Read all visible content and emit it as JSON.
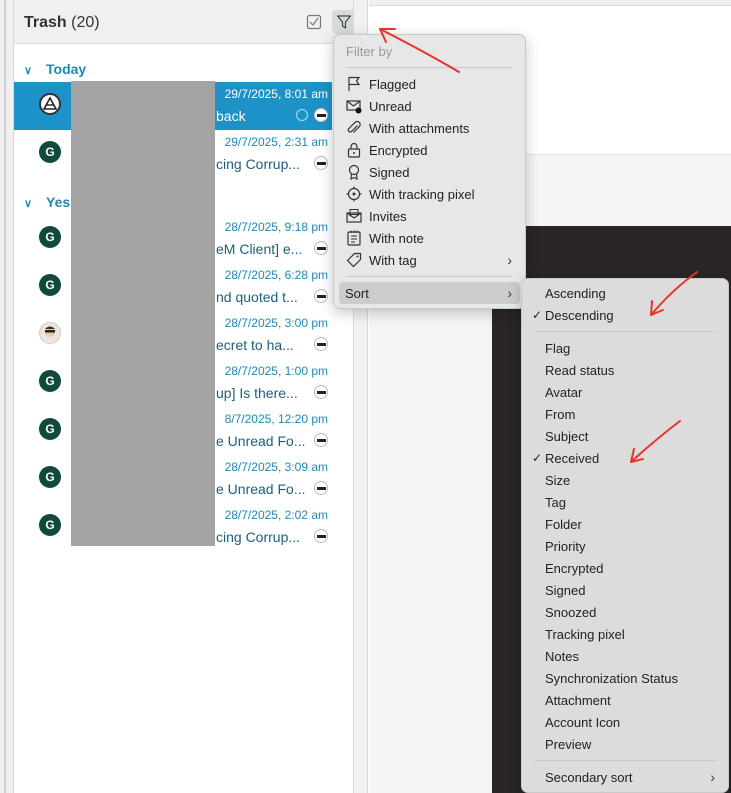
{
  "folder": {
    "name": "Trash",
    "count": "(20)"
  },
  "groups": {
    "today": "Today",
    "yesterday": "Yes"
  },
  "messages": [
    {
      "date": "29/7/2025, 8:01 am",
      "subject": "back"
    },
    {
      "date": "29/7/2025, 2:31 am",
      "subject": "cing Corrup..."
    },
    {
      "date": "28/7/2025, 9:18 pm",
      "subject": "eM Client] e..."
    },
    {
      "date": "28/7/2025, 6:28 pm",
      "subject": "nd quoted t..."
    },
    {
      "date": "28/7/2025, 3:00 pm",
      "subject": "ecret to ha..."
    },
    {
      "date": "28/7/2025, 1:00 pm",
      "subject": "up] Is there..."
    },
    {
      "date": "8/7/2025, 12:20 pm",
      "subject": "e Unread Fo..."
    },
    {
      "date": "28/7/2025, 3:09 am",
      "subject": "e Unread Fo..."
    },
    {
      "date": "28/7/2025, 2:02 am",
      "subject": "cing Corrup..."
    }
  ],
  "avatars": [
    "A",
    "G",
    "G",
    "G",
    "",
    "G",
    "G",
    "G",
    "G"
  ],
  "filter_menu": {
    "header": "Filter by",
    "items": [
      {
        "label": "Flagged",
        "icon": "flag-icon"
      },
      {
        "label": "Unread",
        "icon": "unread-envelope-icon"
      },
      {
        "label": "With attachments",
        "icon": "paperclip-icon"
      },
      {
        "label": "Encrypted",
        "icon": "lock-icon"
      },
      {
        "label": "Signed",
        "icon": "ribbon-icon"
      },
      {
        "label": "With tracking pixel",
        "icon": "crosshair-icon"
      },
      {
        "label": "Invites",
        "icon": "invite-envelope-icon"
      },
      {
        "label": "With note",
        "icon": "note-icon"
      },
      {
        "label": "With tag",
        "icon": "tag-icon"
      }
    ],
    "sort_label": "Sort"
  },
  "sort_menu": {
    "order": [
      "Ascending",
      "Descending"
    ],
    "order_checked": "Descending",
    "fields": [
      "Flag",
      "Read status",
      "Avatar",
      "From",
      "Subject",
      "Received",
      "Size",
      "Tag",
      "Folder",
      "Priority",
      "Encrypted",
      "Signed",
      "Snoozed",
      "Tracking pixel",
      "Notes",
      "Synchronization Status",
      "Attachment",
      "Account Icon",
      "Preview"
    ],
    "field_checked": "Received",
    "secondary": "Secondary sort"
  },
  "colors": {
    "accent": "#1d8ab6",
    "selected": "#1c92c8",
    "annotation": "#e8322b"
  }
}
